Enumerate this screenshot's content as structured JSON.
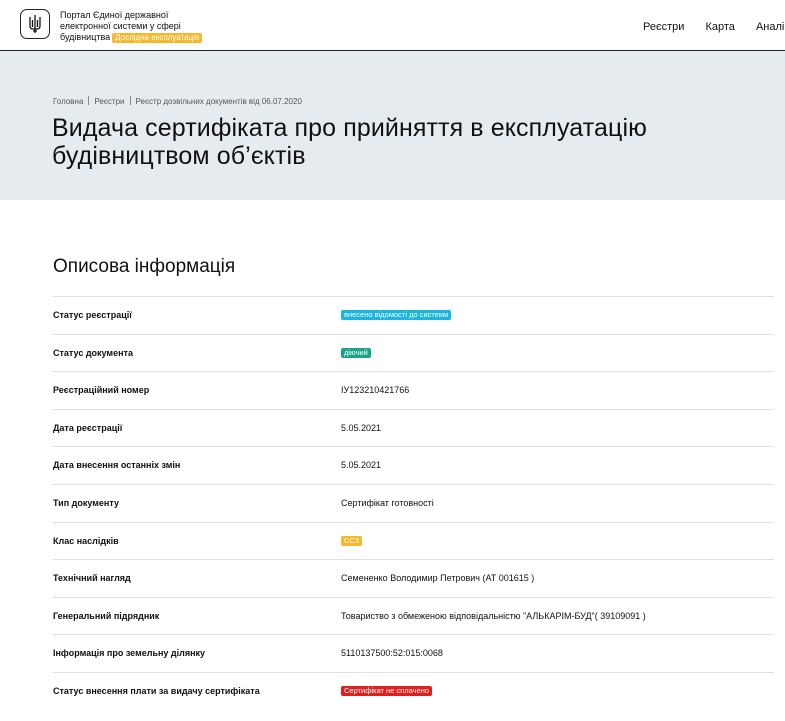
{
  "header": {
    "brand_line1": "Портал Єдиної державної",
    "brand_line2": "електронної системи у сфері",
    "brand_line3": "будівництва",
    "brand_badge": "Дослідна експлуатація",
    "nav": [
      "Реєстри",
      "Карта",
      "Аналі"
    ]
  },
  "breadcrumbs": [
    "Головна",
    "Реєстри",
    "Реєстр дозвільних документів від 06.07.2020"
  ],
  "page_title_line1": "Видача сертифіката про прийняття в експлуатацію",
  "page_title_line2": "будівництвом об’єктів",
  "section_title": "Описова інформація",
  "rows": [
    {
      "label": "Статус реєстрації",
      "value": "внесено відомості до системи",
      "badge_color": "#1bb5e0"
    },
    {
      "label": "Статус документа",
      "value": "діючий",
      "badge_color": "#1aa38a"
    },
    {
      "label": "Реєстраційний номер",
      "value": "ІУ123210421766"
    },
    {
      "label": "Дата реєстрації",
      "value": "5.05.2021"
    },
    {
      "label": "Дата внесення останніх змін",
      "value": "5.05.2021"
    },
    {
      "label": "Тип документу",
      "value": "Сертифікат готовності"
    },
    {
      "label": "Клас наслідків",
      "value": "СС3",
      "badge_color": "#f5b82e"
    },
    {
      "label": "Технічний нагляд",
      "value": "Семененко Володимир Петрович (АТ 001615 )"
    },
    {
      "label": "Генеральний підрядник",
      "value": "Товариство з обмеженою відповідальністю \"АЛЬКАРІМ-БУД\"( 39109091 )"
    },
    {
      "label": "Інформація про земельну ділянку",
      "value": "5110137500:52:015:0068"
    },
    {
      "label": "Статус внесення плати за видачу сертифіката",
      "value": "Сертифікат не сплачено",
      "badge_color": "#e02020"
    }
  ]
}
